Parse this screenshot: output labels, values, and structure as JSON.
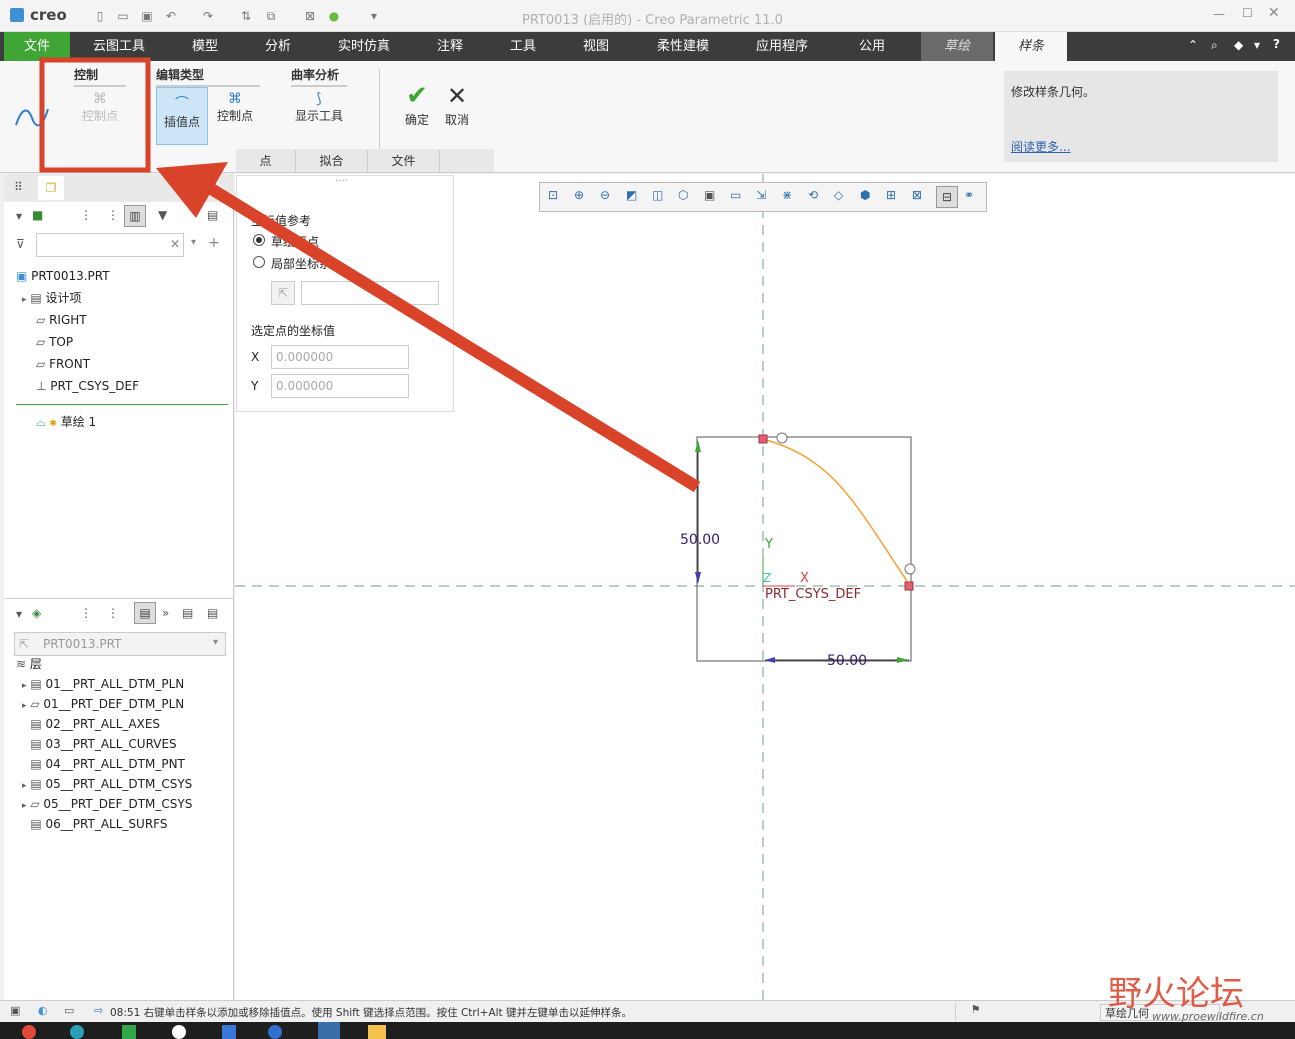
{
  "titlebar": {
    "app_logo": "creo",
    "window_title": "PRT0013 (启用的) - Creo Parametric 11.0"
  },
  "tabs": [
    {
      "label": "文件"
    },
    {
      "label": "云图工具"
    },
    {
      "label": "模型"
    },
    {
      "label": "分析"
    },
    {
      "label": "实时仿真"
    },
    {
      "label": "注释"
    },
    {
      "label": "工具"
    },
    {
      "label": "视图"
    },
    {
      "label": "柔性建模"
    },
    {
      "label": "应用程序"
    },
    {
      "label": "公用"
    },
    {
      "label": "草绘"
    },
    {
      "label": "样条"
    }
  ],
  "ribbon": {
    "control_group": {
      "title": "控制",
      "button": "控制点"
    },
    "edit_type_group": {
      "title": "编辑类型",
      "interp_button": "插值点",
      "control_button": "控制点"
    },
    "curvature_group": {
      "title": "曲率分析",
      "button": "显示工具"
    },
    "ok_label": "确定",
    "cancel_label": "取消",
    "subtabs": [
      "点",
      "拟合",
      "文件"
    ],
    "help": {
      "text": "修改样条几何。",
      "link": "阅读更多..."
    }
  },
  "dialog": {
    "ref_title": "坐标值参考",
    "opt1": "草绘原点",
    "opt2": "局部坐标系",
    "coord_title": "选定点的坐标值",
    "x_label": "X",
    "y_label": "Y",
    "x_value": "0.000000",
    "y_value": "0.000000"
  },
  "model_tree": {
    "root": "PRT0013.PRT",
    "items": [
      {
        "label": "设计项"
      },
      {
        "label": "RIGHT"
      },
      {
        "label": "TOP"
      },
      {
        "label": "FRONT"
      },
      {
        "label": "PRT_CSYS_DEF"
      }
    ],
    "sketch_item": "草绘 1"
  },
  "layer_tree": {
    "model_select": "PRT0013.PRT",
    "root": "层",
    "items": [
      {
        "label": "01__PRT_ALL_DTM_PLN"
      },
      {
        "label": "01__PRT_DEF_DTM_PLN"
      },
      {
        "label": "02__PRT_ALL_AXES"
      },
      {
        "label": "03__PRT_ALL_CURVES"
      },
      {
        "label": "04__PRT_ALL_DTM_PNT"
      },
      {
        "label": "05__PRT_ALL_DTM_CSYS"
      },
      {
        "label": "05__PRT_DEF_DTM_CSYS"
      },
      {
        "label": "06__PRT_ALL_SURFS"
      }
    ]
  },
  "sketch": {
    "dim_vertical": "50.00",
    "dim_horizontal": "50.00",
    "csys_label": "PRT_CSYS_DEF",
    "axis_y": "Y",
    "axis_x": "X",
    "axis_z": "Z"
  },
  "status": {
    "message": "08:51 右键单击样条以添加或移除插值点。使用 Shift 键选择点范围。按住 Ctrl+Alt 键并左键单击以延伸样条。",
    "filter": "草绘几何"
  },
  "watermark": {
    "text": "野火论坛",
    "url": "www.proewildfire.cn"
  },
  "colors": {
    "accent_green": "#3fa535",
    "tab_bar": "#3c3c3c",
    "annotation_red": "#d9432a",
    "spline_orange": "#f7a030"
  }
}
